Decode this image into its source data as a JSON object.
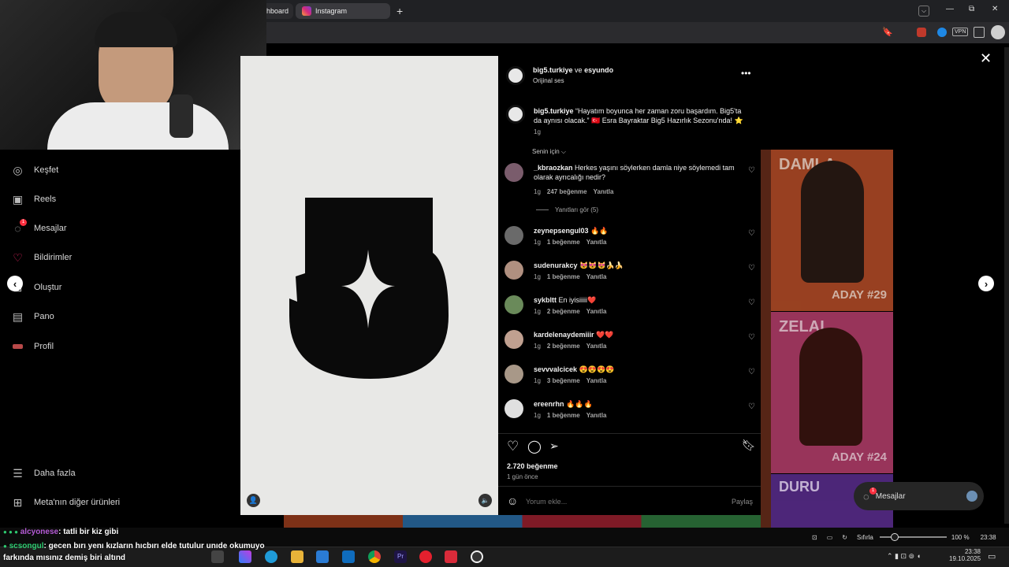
{
  "browser": {
    "tabs": [
      {
        "label": "hboard"
      },
      {
        "label": "Instagram",
        "active": true
      }
    ],
    "new_tab": "+",
    "window_controls": {
      "minimize": "—",
      "maximize": "⧉",
      "close": "✕"
    },
    "vpn_badge": "VPN"
  },
  "sidebar": {
    "items": [
      {
        "label": "Keşfet",
        "icon": "compass-icon"
      },
      {
        "label": "Reels",
        "icon": "reels-icon"
      },
      {
        "label": "Mesajlar",
        "icon": "messenger-icon",
        "badge": "1"
      },
      {
        "label": "Bildirimler",
        "icon": "heart-icon"
      },
      {
        "label": "Oluştur",
        "icon": "plus-icon"
      },
      {
        "label": "Pano",
        "icon": "dashboard-icon"
      },
      {
        "label": "Profil",
        "icon": "profile-icon"
      }
    ],
    "more": "Daha fazla",
    "meta_products": "Meta'nın diğer ürünleri"
  },
  "post": {
    "header": {
      "user1": "big5.turkiye",
      "connector": "ve",
      "user2": "esyundo",
      "audio": "Orijinal ses"
    },
    "caption": {
      "user": "big5.turkiye",
      "text": "“Hayatım boyunca her zaman zoru başardım. Big5'ta da aynısı olacak.” 🇹🇷 Esra Bayraktar Big5 Hazırlık Sezonu'nda! ⭐",
      "time": "1g"
    },
    "filter": "Senin için ⌵",
    "comments": [
      {
        "user": "_kbraozkan",
        "text": "Herkes yaşını söylerken damla niye söylemedi tam olarak ayrıcalığı nedir?",
        "time": "1g",
        "likes": "247 beğenme",
        "reply": "Yanıtla"
      },
      {
        "user": "zeynepsengul03",
        "text": "🔥🔥",
        "time": "1g",
        "likes": "1 beğenme",
        "reply": "Yanıtla"
      },
      {
        "user": "sudenurakcy",
        "text": "😻😻😻🍌🍌",
        "time": "1g",
        "likes": "1 beğenme",
        "reply": "Yanıtla"
      },
      {
        "user": "sykbltt",
        "text": "En iyisiiiii❤️",
        "time": "1g",
        "likes": "2 beğenme",
        "reply": "Yanıtla"
      },
      {
        "user": "kardelenaydemiiir",
        "text": "❤️❤️",
        "time": "1g",
        "likes": "2 beğenme",
        "reply": "Yanıtla"
      },
      {
        "user": "sevvvalcicek",
        "text": "😍😍😍😍",
        "time": "1g",
        "likes": "3 beğenme",
        "reply": "Yanıtla"
      },
      {
        "user": "ereenrhn",
        "text": "🔥🔥🔥",
        "time": "1g",
        "likes": "1 beğenme",
        "reply": "Yanıtla"
      }
    ],
    "view_replies": "Yanıtları gör (5)",
    "likes_total": "2.720 beğenme",
    "posted": "1 gün önce",
    "comment_placeholder": "Yorum ekle...",
    "share_label": "Paylaş"
  },
  "background_cards": [
    {
      "name": "DAMLA",
      "tag": "ADAY #29",
      "color": "#d85a2e"
    },
    {
      "name": "ZELAL",
      "tag": "ADAY #24",
      "color": "#d14a7d"
    },
    {
      "name": "DURU",
      "tag": "",
      "color": "#6b35a8"
    }
  ],
  "messages_button": {
    "label": "Mesajlar",
    "badge": "1"
  },
  "chat_overlay": [
    {
      "user": "alcyonese",
      "text": ": tatli bir kiz gibi"
    },
    {
      "user": "scsongul",
      "text": ": gecen bırı yenı kızların hıcbırı elde tutulur unıde okumuyo"
    },
    {
      "user": "",
      "text": "farkında mısınız demiş biri altınd"
    }
  ],
  "taskbar": {
    "reset": "Sıfırla",
    "zoom": "100 %",
    "clock_top": "23:38",
    "time": "23:38",
    "date": "19.10.2025"
  }
}
